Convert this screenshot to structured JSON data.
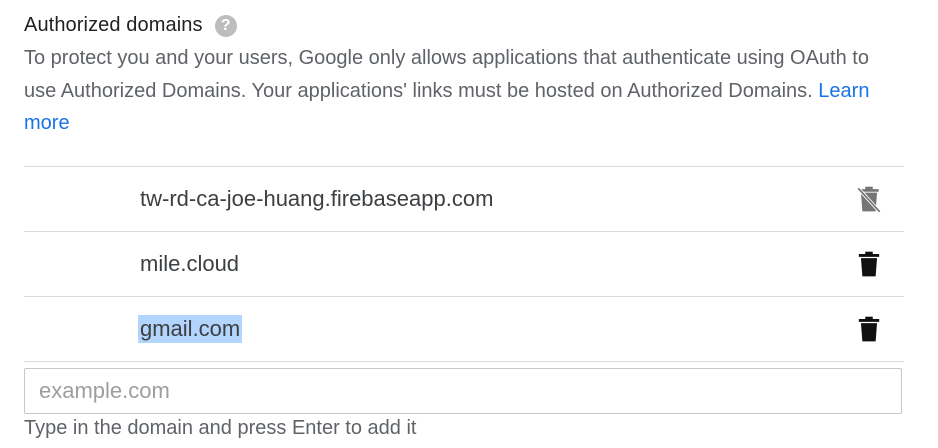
{
  "section": {
    "title": "Authorized domains",
    "help_icon": "question-circle-icon",
    "description": "To protect you and your users, Google only allows applications that authenticate using OAuth to use Authorized Domains. Your applications' links must be hosted on Authorized Domains.",
    "learn_more": "Learn more"
  },
  "domains": [
    {
      "name": "tw-rd-ca-joe-huang.firebaseapp.com",
      "delete_icon": "delete-disabled-icon",
      "deletable": false
    },
    {
      "name": "mile.cloud",
      "delete_icon": "delete-icon",
      "deletable": true
    },
    {
      "name": "gmail.com",
      "delete_icon": "delete-icon",
      "deletable": true,
      "selected": true
    }
  ],
  "new_domain": {
    "placeholder": "example.com",
    "value": "",
    "hint": "Type in the domain and press Enter to add it"
  },
  "colors": {
    "link": "#1a73e8",
    "selection": "#b3d4fc",
    "divider": "#dadce0"
  }
}
